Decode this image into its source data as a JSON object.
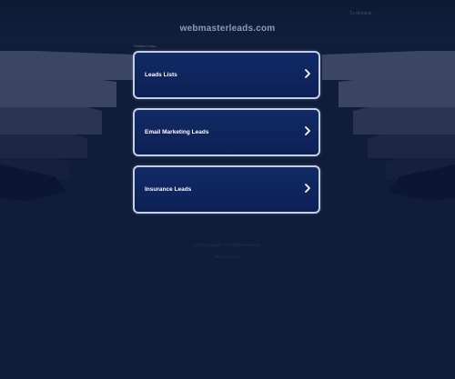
{
  "header": {
    "site_title": "webmasterleads.com",
    "top_link": "Tu dominio"
  },
  "related": {
    "label": "Related Links",
    "items": [
      {
        "label": "Leads Lists"
      },
      {
        "label": "Email Marketing Leads"
      },
      {
        "label": "Insurance Leads"
      }
    ]
  },
  "footer": {
    "line1": "2025 Copyright. All Rights Reserved.",
    "line2": "Privacy Policy"
  },
  "colors": {
    "background": "#0f1d3a",
    "box_fill": "#0e2560",
    "box_border": "#c5cfe3"
  }
}
